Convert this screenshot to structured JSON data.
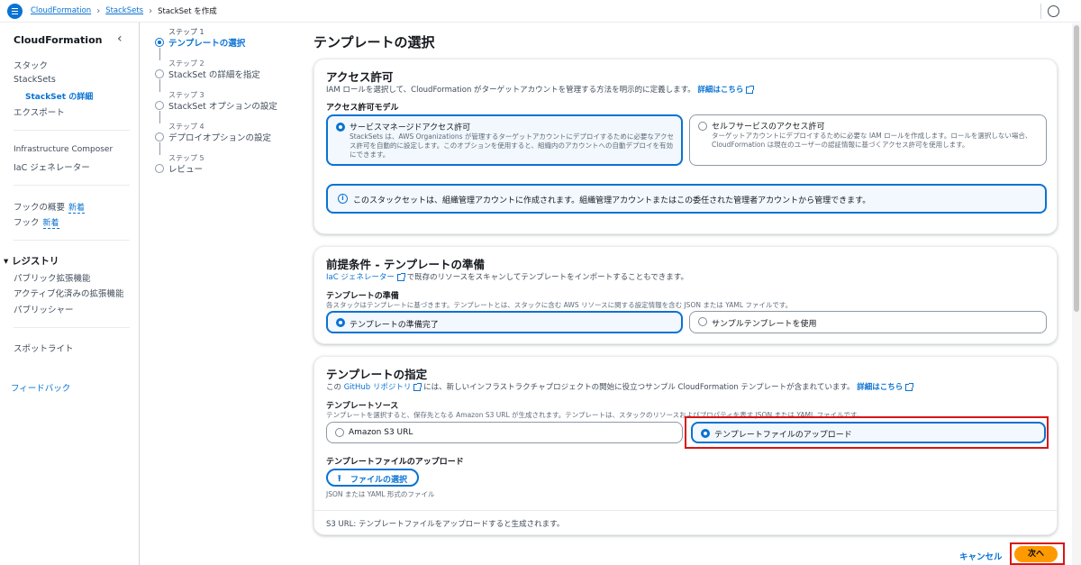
{
  "breadcrumbs": {
    "item1": "CloudFormation",
    "item2": "StackSets",
    "current": "StackSet を作成"
  },
  "sidenav": {
    "title": "CloudFormation",
    "items": {
      "stacks": "スタック",
      "stacksets": "StackSets",
      "stackset_details": "StackSet の詳細",
      "exports": "エクスポート",
      "infra_composer": "Infrastructure Composer",
      "iac_generator": "IaC ジェネレーター",
      "hooks_overview": "フックの概要",
      "hooks": "フック",
      "new_badge": "新着",
      "registry": "レジストリ",
      "public_extensions": "パブリック拡張機能",
      "activated_extensions": "アクティブ化済みの拡張機能",
      "publishers": "パブリッシャー",
      "spotlight": "スポットライト",
      "feedback": "フィードバック"
    }
  },
  "steps": [
    {
      "label": "ステップ 1",
      "title": "テンプレートの選択",
      "active": true
    },
    {
      "label": "ステップ 2",
      "title": "StackSet の詳細を指定",
      "active": false
    },
    {
      "label": "ステップ 3",
      "title": "StackSet オプションの設定",
      "active": false
    },
    {
      "label": "ステップ 4",
      "title": "デプロイオプションの設定",
      "active": false
    },
    {
      "label": "ステップ 5",
      "title": "レビュー",
      "active": false
    }
  ],
  "main": {
    "title": "テンプレートの選択",
    "permissions": {
      "heading": "アクセス許可",
      "description": "IAM ロールを選択して、CloudFormation がターゲットアカウントを管理する方法を明示的に定義します。",
      "learn_more": "詳細はこちら",
      "model_label": "アクセス許可モデル",
      "service_managed": {
        "label": "サービスマネージドアクセス許可",
        "desc": "StackSets は、AWS Organizations が管理するターゲットアカウントにデプロイするために必要なアクセス許可を自動的に設定します。このオプションを使用すると、組織内のアカウントへの自動デプロイを有効にできます。",
        "selected": true
      },
      "self_managed": {
        "label": "セルフサービスのアクセス許可",
        "desc": "ターゲットアカウントにデプロイするために必要な IAM ロールを作成します。ロールを選択しない場合、CloudFormation は現在のユーザーの認証情報に基づくアクセス許可を使用します。",
        "selected": false
      },
      "info_alert": "このスタックセットは、組織管理アカウントに作成されます。組織管理アカウントまたはこの委任された管理者アカウントから管理できます。"
    },
    "prerequisite": {
      "heading": "前提条件 - テンプレートの準備",
      "iac_link": "IaC ジェネレーター",
      "iac_desc": "で既存のリソースをスキャンしてテンプレートをインポートすることもできます。",
      "prepare_label": "テンプレートの準備",
      "prepare_desc": "各スタックはテンプレートに基づきます。テンプレートとは、スタックに含む AWS リソースに関する設定情報を含む JSON または YAML ファイルです。",
      "ready": {
        "label": "テンプレートの準備完了",
        "selected": true
      },
      "sample": {
        "label": "サンプルテンプレートを使用",
        "selected": false
      }
    },
    "specify": {
      "heading": "テンプレートの指定",
      "desc_prefix": "この",
      "github_link": "GitHub リポジトリ",
      "desc_suffix": "には、新しいインフラストラクチャプロジェクトの開始に役立つサンプル CloudFormation テンプレートが含まれています。",
      "learn_more": "詳細はこちら",
      "source_label": "テンプレートソース",
      "source_desc": "テンプレートを選択すると、保存先となる Amazon S3 URL が生成されます。テンプレートは、スタックのリソースおよびプロパティを表す JSON または YAML ファイルです。",
      "s3_url": {
        "label": "Amazon S3 URL",
        "selected": false
      },
      "upload": {
        "label": "テンプレートファイルのアップロード",
        "selected": true
      },
      "upload_label": "テンプレートファイルのアップロード",
      "upload_button": "ファイルの選択",
      "upload_hint": "JSON または YAML 形式のファイル",
      "s3_footer_label": "S3 URL:",
      "s3_footer_value": "テンプレートファイルをアップロードすると生成されます。"
    }
  },
  "actions": {
    "cancel": "キャンセル",
    "next": "次へ"
  },
  "colors": {
    "accent": "#0972d3",
    "primary_button": "#ff9900",
    "highlight": "#d91515"
  }
}
